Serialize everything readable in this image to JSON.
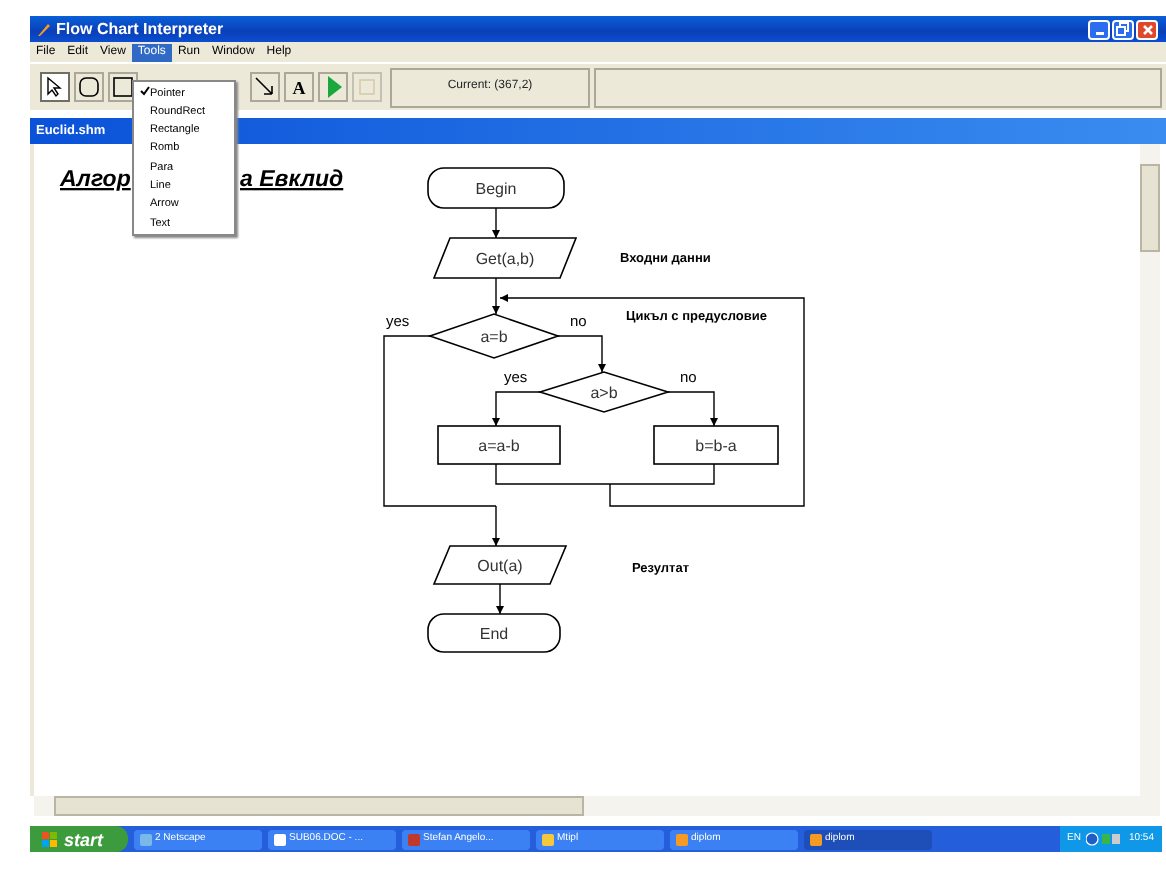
{
  "window": {
    "title": "Flow Chart Interpreter"
  },
  "menu": [
    {
      "label": "File",
      "selected": false
    },
    {
      "label": "Edit",
      "selected": false
    },
    {
      "label": "View",
      "selected": false
    },
    {
      "label": "Tools",
      "selected": true
    },
    {
      "label": "Run",
      "selected": false
    },
    {
      "label": "Window",
      "selected": false
    },
    {
      "label": "Help",
      "selected": false
    }
  ],
  "tools_menu": [
    {
      "label": "Pointer",
      "checked": true
    },
    {
      "label": "RoundRect",
      "checked": false
    },
    {
      "label": "Rectangle",
      "checked": false
    },
    {
      "label": "Romb",
      "checked": false
    },
    {
      "label": "Para",
      "checked": false
    },
    {
      "label": "Line",
      "checked": false
    },
    {
      "label": "Arrow",
      "checked": false
    },
    {
      "label": "Text",
      "checked": false
    }
  ],
  "toolbar": {
    "tools": [
      {
        "kind": "pointer",
        "selected": true,
        "disabled": false
      },
      {
        "kind": "roundrect",
        "selected": false,
        "disabled": false
      },
      {
        "kind": "rectangle",
        "selected": false,
        "disabled": false
      },
      {
        "kind": "arrow",
        "selected": false,
        "disabled": false
      },
      {
        "kind": "text",
        "label": "A",
        "selected": false,
        "disabled": false
      },
      {
        "kind": "run",
        "selected": false,
        "disabled": false
      },
      {
        "kind": "stop",
        "selected": false,
        "disabled": true
      }
    ],
    "status": "Current: (367,2)"
  },
  "document": {
    "title": "Euclid.shm",
    "heading_parts": [
      "Алгор",
      "а Евклид"
    ],
    "flowchart": {
      "nodes": [
        {
          "kind": "terminal",
          "text": "Begin"
        },
        {
          "kind": "io",
          "text": "Get(a,b)"
        },
        {
          "kind": "decision",
          "text": "a=b"
        },
        {
          "kind": "decision",
          "text": "a>b"
        },
        {
          "kind": "process",
          "text": "a=a-b"
        },
        {
          "kind": "process",
          "text": "b=b-a"
        },
        {
          "kind": "io",
          "text": "Out(a)"
        },
        {
          "kind": "terminal",
          "text": "End"
        }
      ],
      "branch_labels": [
        "yes",
        "no",
        "yes",
        "no"
      ],
      "comments": [
        "Входни данни",
        "Цикъл с предусловие",
        "Резултат"
      ]
    }
  },
  "taskbar": {
    "start": "start",
    "tasks": [
      {
        "label": "2 Netscape",
        "active": false
      },
      {
        "label": "SUB06.DOC - ...",
        "active": false
      },
      {
        "label": "Stefan Angelo...",
        "active": false
      },
      {
        "label": "Mtipl",
        "active": false
      },
      {
        "label": "diplom",
        "active": false
      },
      {
        "label": "diplom",
        "active": true
      }
    ],
    "language": "EN",
    "clock": "10:54"
  }
}
